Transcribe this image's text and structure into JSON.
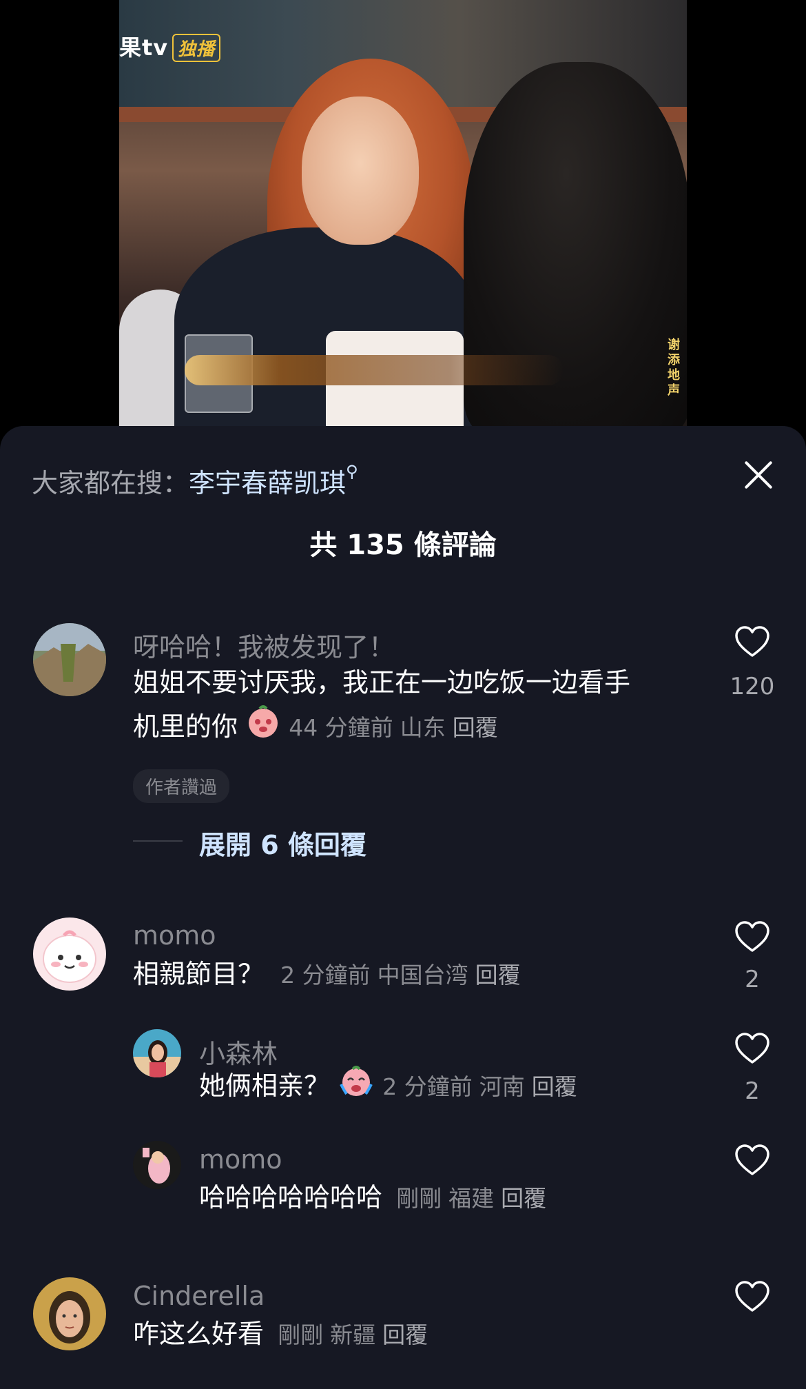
{
  "video": {
    "logo_text": "果tv",
    "logo_tag": "独播",
    "side_text": "谢添地 声"
  },
  "search": {
    "prefix": "大家都在搜：",
    "term": "李宇春薛凯琪",
    "icon": "search-magnifier-icon"
  },
  "header": {
    "title": "共 135 條評論",
    "close_icon": "close-icon"
  },
  "comments": [
    {
      "username": "呀哈哈！我被发现了！",
      "text_line1": "姐姐不要讨厌我，我正在一边吃饭一边看手",
      "text_line2": "机里的你",
      "emoji": "crying-blush-emoji",
      "time": "44 分鐘前",
      "location": "山东",
      "reply_label": "回覆",
      "likes": "120",
      "badge": "作者讚過",
      "expand_label": "展開 6 條回覆"
    },
    {
      "username": "momo",
      "text": "相親節目？",
      "time": "2 分鐘前",
      "location": "中国台湾",
      "reply_label": "回覆",
      "likes": "2",
      "replies": [
        {
          "username": "小森林",
          "text": "她俩相亲？",
          "emoji": "crying-laughing-emoji",
          "time": "2 分鐘前",
          "location": "河南",
          "reply_label": "回覆",
          "likes": "2"
        },
        {
          "username": "momo",
          "text": "哈哈哈哈哈哈哈",
          "time": "剛剛",
          "location": "福建",
          "reply_label": "回覆",
          "likes": ""
        }
      ]
    },
    {
      "username": "Cinderella",
      "text": "咋这么好看",
      "time": "剛剛",
      "location": "新疆",
      "reply_label": "回覆",
      "likes": ""
    }
  ],
  "colors": {
    "sheet_bg": "#161823",
    "link_blue": "#cfe4ff",
    "muted_text": "#8a8b91",
    "primary_text": "#ffffff"
  }
}
